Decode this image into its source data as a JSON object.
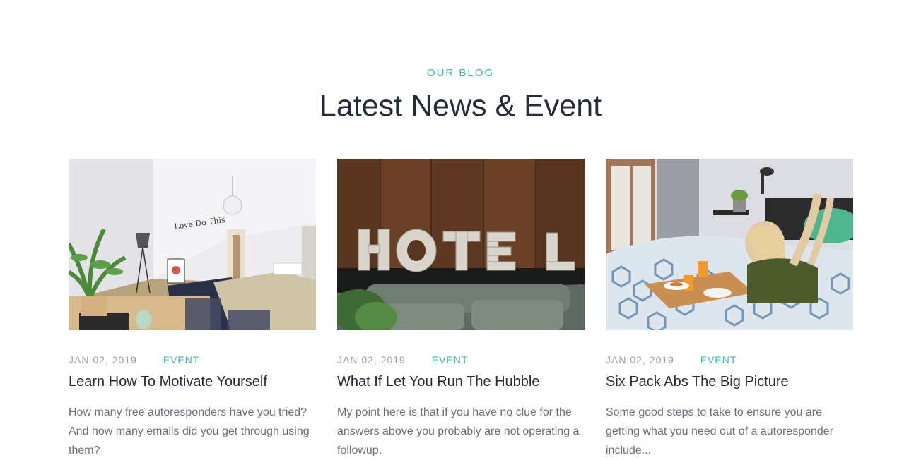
{
  "section": {
    "tag": "OUR BLOG",
    "title": "Latest News & Event"
  },
  "posts": [
    {
      "image": "bright-bedroom-photo",
      "date": "JAN 02, 2019",
      "category": "EVENT",
      "title": "Learn How To Motivate Yourself",
      "excerpt": "How many free autoresponders have you tried? And how many emails did you get through using them?"
    },
    {
      "image": "hotel-letters-photo",
      "date": "JAN 02, 2019",
      "category": "EVENT",
      "title": "What If Let You Run The Hubble",
      "excerpt": "My point here is that if you have no clue for the answers above you probably are not operating a followup."
    },
    {
      "image": "breakfast-in-bed-photo",
      "date": "JAN 02, 2019",
      "category": "EVENT",
      "title": "Six Pack Abs The Big Picture",
      "excerpt": "Some good steps to take to ensure you are getting what you need out of a autoresponder include..."
    }
  ],
  "colors": {
    "accent": "#3fb8a7",
    "heading": "#262b38",
    "meta": "#9aa0a8",
    "body": "#6b717c"
  }
}
